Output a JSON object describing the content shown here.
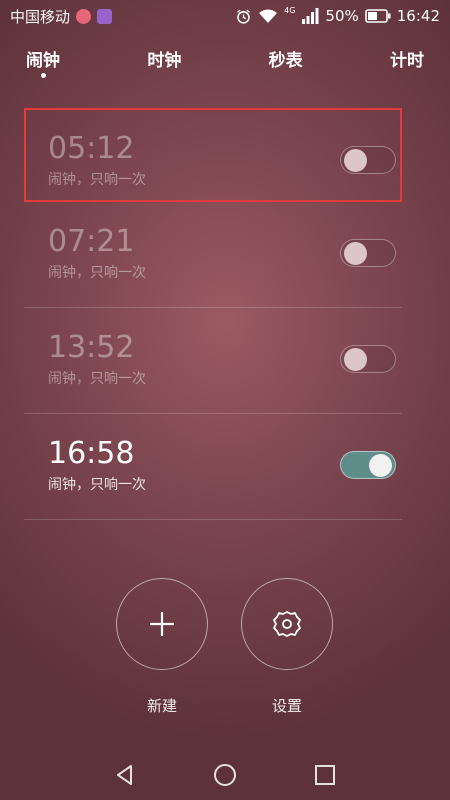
{
  "status_bar": {
    "carrier": "中国移动",
    "network": "4G",
    "battery_percent": "50%",
    "time": "16:42",
    "icons": [
      "heart-app-icon",
      "purple-app-icon",
      "alarm-clock-icon",
      "wifi-icon",
      "signal-icon",
      "battery-icon"
    ]
  },
  "tabs": [
    {
      "label": "闹钟",
      "active": true
    },
    {
      "label": "时钟",
      "active": false
    },
    {
      "label": "秒表",
      "active": false
    },
    {
      "label": "计时",
      "active": false
    }
  ],
  "alarms": [
    {
      "time": "05:12",
      "subtitle": "闹钟，只响一次",
      "enabled": false
    },
    {
      "time": "07:21",
      "subtitle": "闹钟，只响一次",
      "enabled": false
    },
    {
      "time": "13:52",
      "subtitle": "闹钟，只响一次",
      "enabled": false
    },
    {
      "time": "16:58",
      "subtitle": "闹钟，只响一次",
      "enabled": true
    }
  ],
  "actions": {
    "new_label": "新建",
    "settings_label": "设置"
  },
  "colors": {
    "toggle_on": "#5f8d8a",
    "highlight_border": "#e23b3b"
  }
}
